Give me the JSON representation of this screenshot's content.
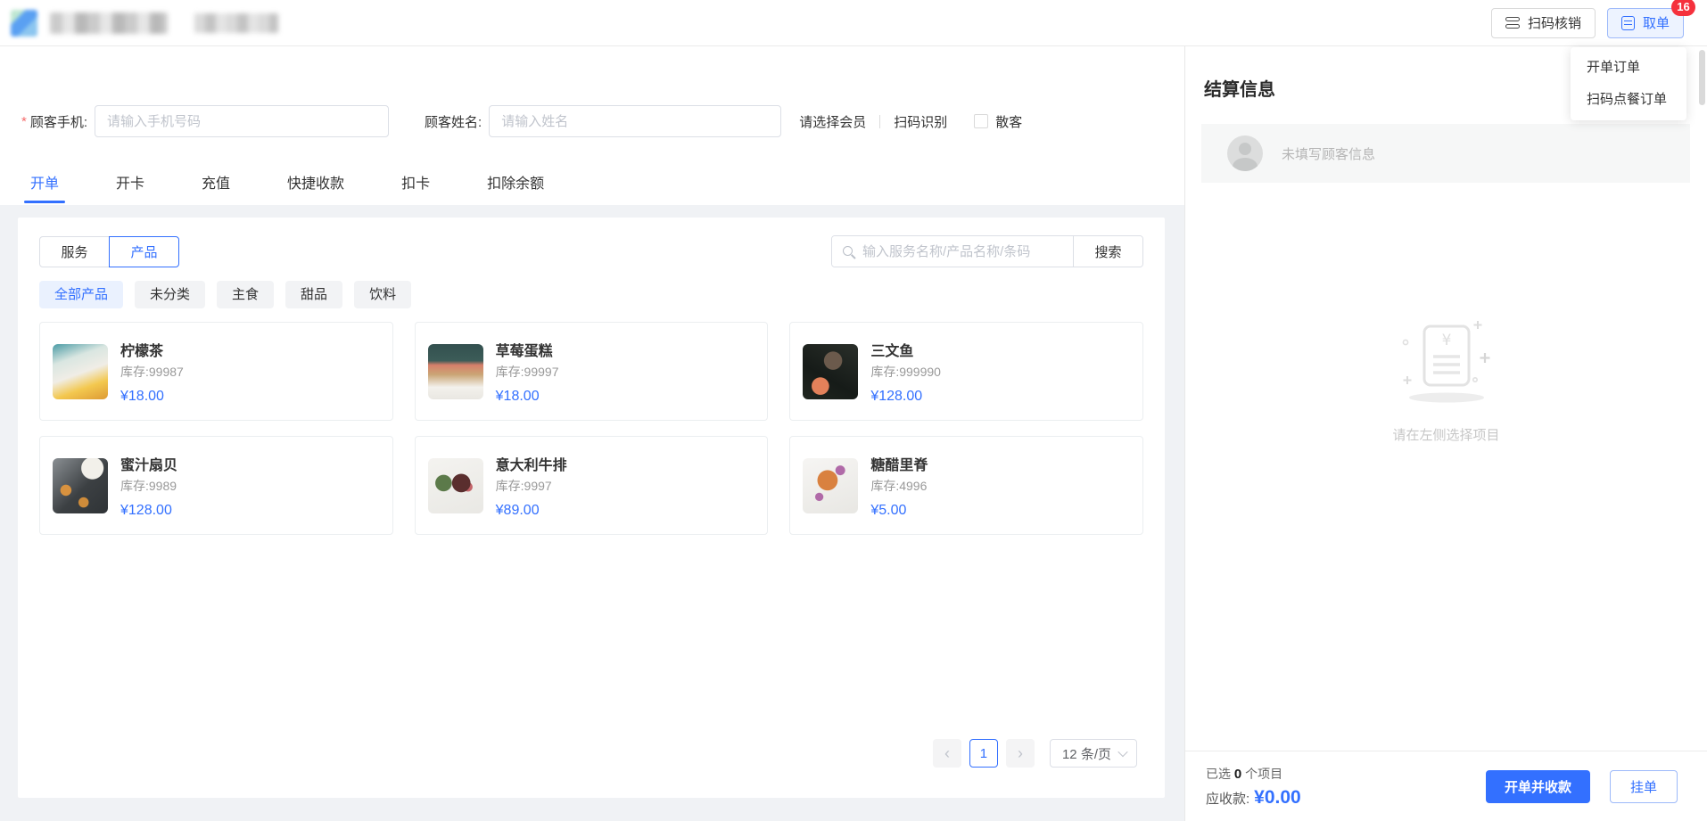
{
  "colors": {
    "primary": "#3370ff",
    "primary_light_bg": "#edf3ff",
    "badge_red": "#f5313d",
    "category_active_bg": "#eaf1fe",
    "gray_bg": "#f0f2f5"
  },
  "icons": {
    "scan_verify": "scan-lines-icon",
    "take_order": "order-doc-icon",
    "search": "magnifier-icon",
    "avatar": "person-icon",
    "empty": "receipt-icon",
    "page_prev": "chevron-left-icon",
    "page_next": "chevron-right-icon",
    "page_size": "chevron-down-icon"
  },
  "topbar": {
    "scan_verify": "扫码核销",
    "take_order": "取单",
    "take_order_badge": "16",
    "menu": {
      "items": [
        {
          "label": "开单订单"
        },
        {
          "label": "扫码点餐订单"
        }
      ]
    }
  },
  "customer": {
    "required_mark": "*",
    "phone_label": "顾客手机:",
    "phone_placeholder": "请输入手机号码",
    "name_label": "顾客姓名:",
    "name_placeholder": "请输入姓名",
    "select_member": "请选择会员",
    "scan_identify": "扫码识别",
    "walk_in": "散客"
  },
  "tabs": [
    {
      "label": "开单"
    },
    {
      "label": "开卡"
    },
    {
      "label": "充值"
    },
    {
      "label": "快捷收款"
    },
    {
      "label": "扣卡"
    },
    {
      "label": "扣除余额"
    }
  ],
  "catalog": {
    "type_service": "服务",
    "type_product": "产品",
    "search_placeholder": "输入服务名称/产品名称/条码",
    "search_button": "搜索",
    "categories": [
      {
        "label": "全部产品"
      },
      {
        "label": "未分类"
      },
      {
        "label": "主食"
      },
      {
        "label": "甜品"
      },
      {
        "label": "饮料"
      }
    ],
    "stock_prefix": "库存:",
    "products": [
      {
        "name": "柠檬茶",
        "stock": "99987",
        "price": "¥18.00"
      },
      {
        "name": "草莓蛋糕",
        "stock": "99997",
        "price": "¥18.00"
      },
      {
        "name": "三文鱼",
        "stock": "999990",
        "price": "¥128.00"
      },
      {
        "name": "蜜汁扇贝",
        "stock": "9989",
        "price": "¥128.00"
      },
      {
        "name": "意大利牛排",
        "stock": "9997",
        "price": "¥89.00"
      },
      {
        "name": "糖醋里脊",
        "stock": "4996",
        "price": "¥5.00"
      }
    ],
    "pagination": {
      "prev": "‹",
      "current": "1",
      "next": "›",
      "page_size": "12 条/页"
    }
  },
  "checkout": {
    "title": "结算信息",
    "no_customer": "未填写顾客信息",
    "empty_hint": "请在左侧选择项目",
    "selected_prefix": "已选",
    "selected_count": "0",
    "selected_suffix": "个项目",
    "receivable_label": "应收款:",
    "receivable_amount": "¥0.00",
    "pay_button": "开单并收款",
    "hold_button": "挂单"
  }
}
